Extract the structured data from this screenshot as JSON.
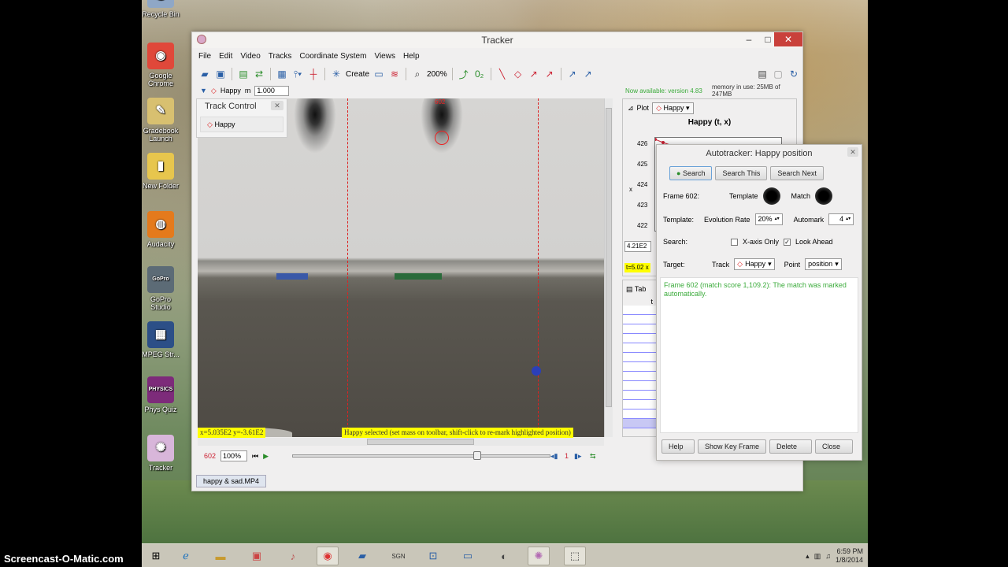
{
  "desktop": {
    "icons": [
      {
        "label": "Recycle Bin",
        "glyph": "🗑",
        "color": "#8fa7c6"
      },
      {
        "label": "Google Chrome",
        "glyph": "◉",
        "color": "#e0483a"
      },
      {
        "label": "Gradebook Launch",
        "glyph": "✎",
        "color": "#d8c070"
      },
      {
        "label": "New Folder",
        "glyph": "▮",
        "color": "#e7c64d"
      },
      {
        "label": "Audacity",
        "glyph": "◍",
        "color": "#e47a1c"
      },
      {
        "label": "GoPro Studio",
        "glyph": "GoPro",
        "color": "#5c6b76"
      },
      {
        "label": "MPEG Str...",
        "glyph": "▦",
        "color": "#2c4f87"
      },
      {
        "label": "Phys Quiz",
        "glyph": "PHYSICS",
        "color": "#7d2b7a"
      },
      {
        "label": "Tracker",
        "glyph": "✺",
        "color": "#d8b6da"
      }
    ]
  },
  "watermark": "Screencast-O-Matic.com",
  "taskbar": {
    "time": "6:59 PM",
    "date": "1/8/2014"
  },
  "window": {
    "title": "Tracker",
    "controls": {
      "minimize": "–",
      "maximize": "□",
      "close": "✕"
    },
    "menu": [
      "File",
      "Edit",
      "Video",
      "Tracks",
      "Coordinate System",
      "Views",
      "Help"
    ],
    "toolbar": {
      "create_label": "Create",
      "zoom_label": "200%"
    },
    "trackbar": {
      "track_name": "Happy",
      "mass_label": "m",
      "mass_value": "1.000",
      "available": "Now available: version 4.83",
      "memory": "memory in use: 25MB of 247MB"
    },
    "track_control": {
      "title": "Track Control",
      "track_button": "Happy"
    },
    "video": {
      "coord_readout": "x=5.035E2  y=-3.61E2",
      "hint": "Happy selected (set mass on toolbar, shift-click to re-mark highlighted position)",
      "frame_label": "602"
    },
    "player": {
      "frame": "602",
      "zoom": "100%",
      "step": "1",
      "slider_position": 0.72
    },
    "file_tab": "happy & sad.MP4",
    "plot": {
      "tab_label": "Plot",
      "track": "Happy",
      "title": "Happy (t, x)",
      "y_axis_label": "x",
      "yticks": [
        "426",
        "425",
        "424",
        "423",
        "422"
      ],
      "readout": "4.21E2",
      "t_readout": "t=5.02  x"
    },
    "table": {
      "tab_label": "Tab",
      "column": "t"
    }
  },
  "autotracker": {
    "title": "Autotracker: Happy position",
    "search_button": "Search",
    "search_this_button": "Search This",
    "search_next_button": "Search Next",
    "frame_label": "Frame 602:",
    "template_label": "Template",
    "match_label": "Match",
    "template_row_label": "Template:",
    "evolution_label": "Evolution Rate",
    "evolution_value": "20%",
    "automark_label": "Automark",
    "automark_value": "4",
    "search_label": "Search:",
    "xaxis_label": "X-axis Only",
    "lookahead_label": "Look Ahead",
    "xaxis_checked": false,
    "lookahead_checked": true,
    "target_label": "Target:",
    "track_label": "Track",
    "track_value": "Happy",
    "point_label": "Point",
    "point_value": "position",
    "message": "Frame 602 (match score 1,109.2): The match was marked automatically.",
    "help_button": "Help",
    "show_key_button": "Show Key Frame",
    "delete_button": "Delete",
    "close_button": "Close"
  }
}
